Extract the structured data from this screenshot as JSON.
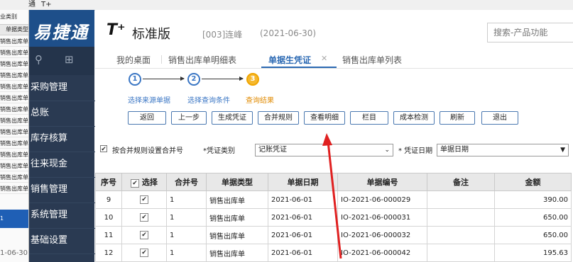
{
  "titlebar": {
    "t1": "通",
    "t2": "T+"
  },
  "bg_window": {
    "label1": "业类别",
    "header": "单据类型",
    "rows": [
      "销售出库单",
      "销售出库单",
      "销售出库单",
      "销售出库单",
      "销售出库单",
      "销售出库单",
      "销售出库单",
      "销售出库单",
      "销售出库单",
      "销售出库单",
      "销售出库单",
      "销售出库单",
      "销售出库单",
      "销售出库单"
    ],
    "selected": "1",
    "date": "1-06-30"
  },
  "sidebar": {
    "brand": "易捷通",
    "menu": [
      "采购管理",
      "总账",
      "库存核算",
      "往来现金",
      "销售管理",
      "系统管理",
      "基础设置"
    ]
  },
  "header": {
    "logo": "T⁺",
    "product": "标准版",
    "account": "[003]连峰",
    "date": "(2021-06-30)",
    "search_placeholder": "搜索-产品功能"
  },
  "tabs": [
    "我的桌面",
    "销售出库单明细表",
    "单据生凭证",
    "销售出库单列表"
  ],
  "active_tab": 2,
  "steps": {
    "labels": [
      "选择来源单据",
      "选择查询条件",
      "查询结果"
    ],
    "numbers": [
      "1",
      "2",
      "3"
    ],
    "current": 2
  },
  "buttons": [
    "返回",
    "上一步",
    "生成凭证",
    "合并规则",
    "查看明细",
    "栏目",
    "成本检测",
    "刷新",
    "退出"
  ],
  "options": {
    "merge_by_rule": "按合并规则设置合并号",
    "voucher_type_label": "*凭证类别",
    "voucher_type_value": "记账凭证",
    "voucher_date_label": "* 凭证日期",
    "voucher_date_value": "单据日期"
  },
  "table": {
    "columns": [
      "序号",
      "选择",
      "合并号",
      "单据类型",
      "单据日期",
      "单据编号",
      "备注",
      "金额"
    ],
    "rows": [
      {
        "seq": "9",
        "merge": "1",
        "type": "销售出库单",
        "date": "2021-06-01",
        "no": "IO-2021-06-000029",
        "note": "",
        "amount": "390.00"
      },
      {
        "seq": "10",
        "merge": "1",
        "type": "销售出库单",
        "date": "2021-06-01",
        "no": "IO-2021-06-000031",
        "note": "",
        "amount": "650.00"
      },
      {
        "seq": "11",
        "merge": "1",
        "type": "销售出库单",
        "date": "2021-06-01",
        "no": "IO-2021-06-000032",
        "note": "",
        "amount": "650.00"
      },
      {
        "seq": "12",
        "merge": "1",
        "type": "销售出库单",
        "date": "2021-06-01",
        "no": "IO-2021-06-000042",
        "note": "",
        "amount": "195.63"
      }
    ]
  },
  "colors": {
    "sidebar": "#2a3a52",
    "brand": "#1e4f8a",
    "accent": "#2b69b3",
    "annotation": "#e02020"
  }
}
